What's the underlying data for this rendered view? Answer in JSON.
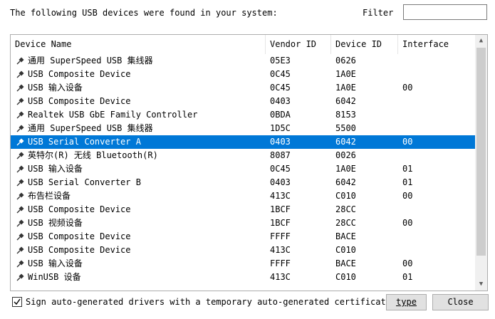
{
  "header": {
    "text": "The following USB devices were found in your system:",
    "filter_label": "Filter",
    "filter_value": ""
  },
  "table": {
    "columns": [
      "Device Name",
      "Vendor ID",
      "Device ID",
      "Interface"
    ],
    "rows": [
      {
        "name": "通用 SuperSpeed USB 集线器",
        "vendor": "05E3",
        "device": "0626",
        "iface": ""
      },
      {
        "name": "USB Composite Device",
        "vendor": "0C45",
        "device": "1A0E",
        "iface": ""
      },
      {
        "name": "USB 输入设备",
        "vendor": "0C45",
        "device": "1A0E",
        "iface": "00"
      },
      {
        "name": "USB Composite Device",
        "vendor": "0403",
        "device": "6042",
        "iface": ""
      },
      {
        "name": "Realtek USB GbE Family Controller",
        "vendor": "0BDA",
        "device": "8153",
        "iface": ""
      },
      {
        "name": "通用 SuperSpeed USB 集线器",
        "vendor": "1D5C",
        "device": "5500",
        "iface": ""
      },
      {
        "name": "USB Serial Converter A",
        "vendor": "0403",
        "device": "6042",
        "iface": "00",
        "selected": true
      },
      {
        "name": "英特尔(R) 无线 Bluetooth(R)",
        "vendor": "8087",
        "device": "0026",
        "iface": ""
      },
      {
        "name": "USB 输入设备",
        "vendor": "0C45",
        "device": "1A0E",
        "iface": "01"
      },
      {
        "name": "USB Serial Converter B",
        "vendor": "0403",
        "device": "6042",
        "iface": "01"
      },
      {
        "name": "布告栏设备",
        "vendor": "413C",
        "device": "C010",
        "iface": "00"
      },
      {
        "name": "USB Composite Device",
        "vendor": "1BCF",
        "device": "28CC",
        "iface": ""
      },
      {
        "name": "USB 视频设备",
        "vendor": "1BCF",
        "device": "28CC",
        "iface": "00"
      },
      {
        "name": "USB Composite Device",
        "vendor": "FFFF",
        "device": "BACE",
        "iface": ""
      },
      {
        "name": "USB Composite Device",
        "vendor": "413C",
        "device": "C010",
        "iface": ""
      },
      {
        "name": "USB 输入设备",
        "vendor": "FFFF",
        "device": "BACE",
        "iface": "00"
      },
      {
        "name": "WinUSB 设备",
        "vendor": "413C",
        "device": "C010",
        "iface": "01"
      }
    ]
  },
  "footer": {
    "checkbox_label": "Sign auto-generated drivers with a temporary auto-generated certificate",
    "checkbox_checked": true,
    "type_button": "type",
    "close_button": "Close"
  },
  "colors": {
    "selection": "#0078d7",
    "scrollbar_thumb": "#cdcdcd"
  },
  "icons": {
    "device": "usb-plug-icon"
  }
}
